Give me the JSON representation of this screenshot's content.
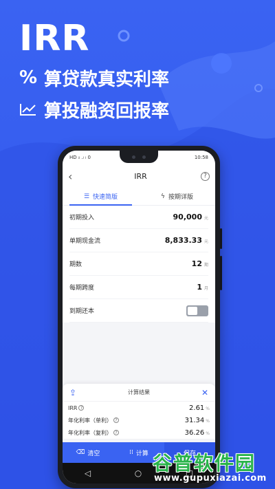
{
  "promo": {
    "title": "IRR",
    "line1": "算贷款真实利率",
    "line2": "算投融资回报率",
    "line1_glyph": "%"
  },
  "colors": {
    "brand": "#3a63f2",
    "brand_dark": "#2f55e6",
    "watermark": "#29b34a"
  },
  "statusbar": {
    "left": "HD ᵢₗ .ₗ ₗ 0",
    "right": "10:58"
  },
  "appbar": {
    "title": "IRR",
    "back_icon": "chevron-left-icon",
    "help_icon": "question-circle-icon",
    "help_glyph": "?"
  },
  "tabs": [
    {
      "label": "快速简版",
      "icon": "list-icon",
      "glyph": "☰",
      "active": true
    },
    {
      "label": "按期详版",
      "icon": "bolt-circle-icon",
      "glyph": "ϟ",
      "active": false
    }
  ],
  "form": {
    "rows": [
      {
        "label": "初期投入",
        "value": "90,000",
        "unit": "元"
      },
      {
        "label": "单期现金流",
        "value": "8,833.33",
        "unit": "元"
      },
      {
        "label": "期数",
        "value": "12",
        "unit": "期"
      },
      {
        "label": "每期跨度",
        "value": "1",
        "unit": "月"
      }
    ],
    "toggle_label": "到期还本",
    "toggle_on": false
  },
  "result": {
    "title": "计算结果",
    "share_icon": "share-icon",
    "close_icon": "close-icon",
    "rows": [
      {
        "label": "IRR",
        "value": "2.61",
        "unit": "%"
      },
      {
        "label": "年化利率（单利）",
        "value": "31.34",
        "unit": "%"
      },
      {
        "label": "年化利率（复利）",
        "value": "36.26",
        "unit": "%"
      }
    ]
  },
  "actions": {
    "clear_label": "清空",
    "calc_label": "计算",
    "third_label": "保存"
  },
  "watermark": {
    "text": "谷普软件园",
    "url": "www.gupuxiazai.com"
  }
}
